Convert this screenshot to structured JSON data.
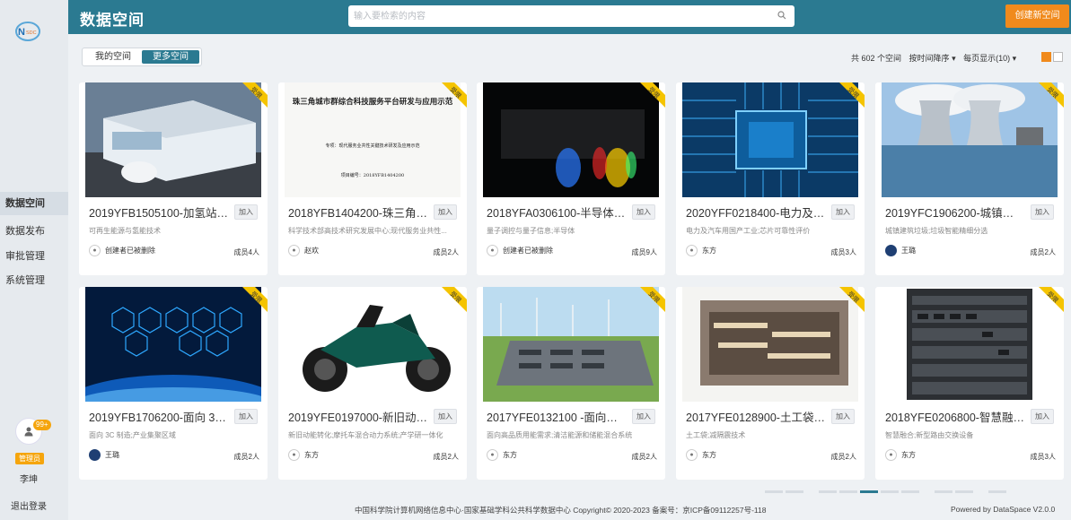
{
  "app": {
    "title": "数据空间",
    "logo_text": "NSDC"
  },
  "header": {
    "search_placeholder": "输入要检索的内容",
    "create_label": "创建新空间"
  },
  "sidebar": {
    "items": [
      {
        "label": "数据空间",
        "active": true
      },
      {
        "label": "数据发布"
      },
      {
        "label": "审批管理"
      },
      {
        "label": "系统管理"
      }
    ],
    "badge": "99+",
    "role": "管理员",
    "user": "李坤",
    "logout": "退出登录"
  },
  "tabs": {
    "mine": "我的空间",
    "more": "更多空间"
  },
  "toolbar": {
    "total": "共 602 个空间",
    "sort": "按时间降序",
    "per_page": "每页显示(10)"
  },
  "ribbon_label": "受限",
  "join_label": "加入",
  "cards": [
    {
      "title": "2019YFB1505100-加氢站用...",
      "desc": "可再生能源与氢能技术",
      "owner": "创建者已被删除",
      "members": "成员4人"
    },
    {
      "title": "2018YFB1404200-珠三角城...",
      "desc": "科学技术部高技术研究发展中心;现代服务业共性...",
      "owner": "赵欢",
      "members": "成员2人"
    },
    {
      "title": "2018YFA0306100-半导体复...",
      "desc": "量子调控与量子信息;半导体",
      "owner": "创建者已被删除",
      "members": "成员9人"
    },
    {
      "title": "2020YFF0218400-电力及汽...",
      "desc": "电力及汽车用国产工业;芯片可靠性评价",
      "owner": "东方",
      "members": "成员3人"
    },
    {
      "title": "2019YFC1906200-城镇建筑...",
      "desc": "城镇建筑垃圾;垃圾智能精细分选",
      "owner": "王璐",
      "members": "成员2人"
    },
    {
      "title": "2019YFB1706200-面向 3C ...",
      "desc": "面向 3C 制造;产业集聚区域",
      "owner": "王璐",
      "members": "成员2人"
    },
    {
      "title": "2019YFE0197000-新旧动能...",
      "desc": "新旧动能转化;摩托车混合动力系统;产学研一体化",
      "owner": "东方",
      "members": "成员2人"
    },
    {
      "title": "2017YFE0132100 -面向高品...",
      "desc": "面向高品质用能需求;清洁能源和储能混合系统",
      "owner": "东方",
      "members": "成员2人"
    },
    {
      "title": "2017YFE0128900-土工袋减...",
      "desc": "土工袋;减隔震技术",
      "owner": "东方",
      "members": "成员2人"
    },
    {
      "title": "2018YFE0206800-智慧融合...",
      "desc": "智慧融合;新型路由交换设备",
      "owner": "东方",
      "members": "成员3人"
    }
  ],
  "doc": {
    "title": "珠三角城市群综合科技服务平台研发与应用示范",
    "subject": "专项：现代服务业共性关键技术研发及应用示范",
    "code": "项目编号：2018YFB1404200"
  },
  "footer": {
    "copyright": "中国科学院计算机网络信息中心·国家基础学科公共科学数据中心 Copyright© 2020-2023 备案号：京ICP备09112257号-118",
    "powered": "Powered by DataSpace V2.0.0"
  },
  "colors": {
    "accent": "#2b7a91",
    "orange": "#f08a1c",
    "ribbon": "#f5c400"
  }
}
